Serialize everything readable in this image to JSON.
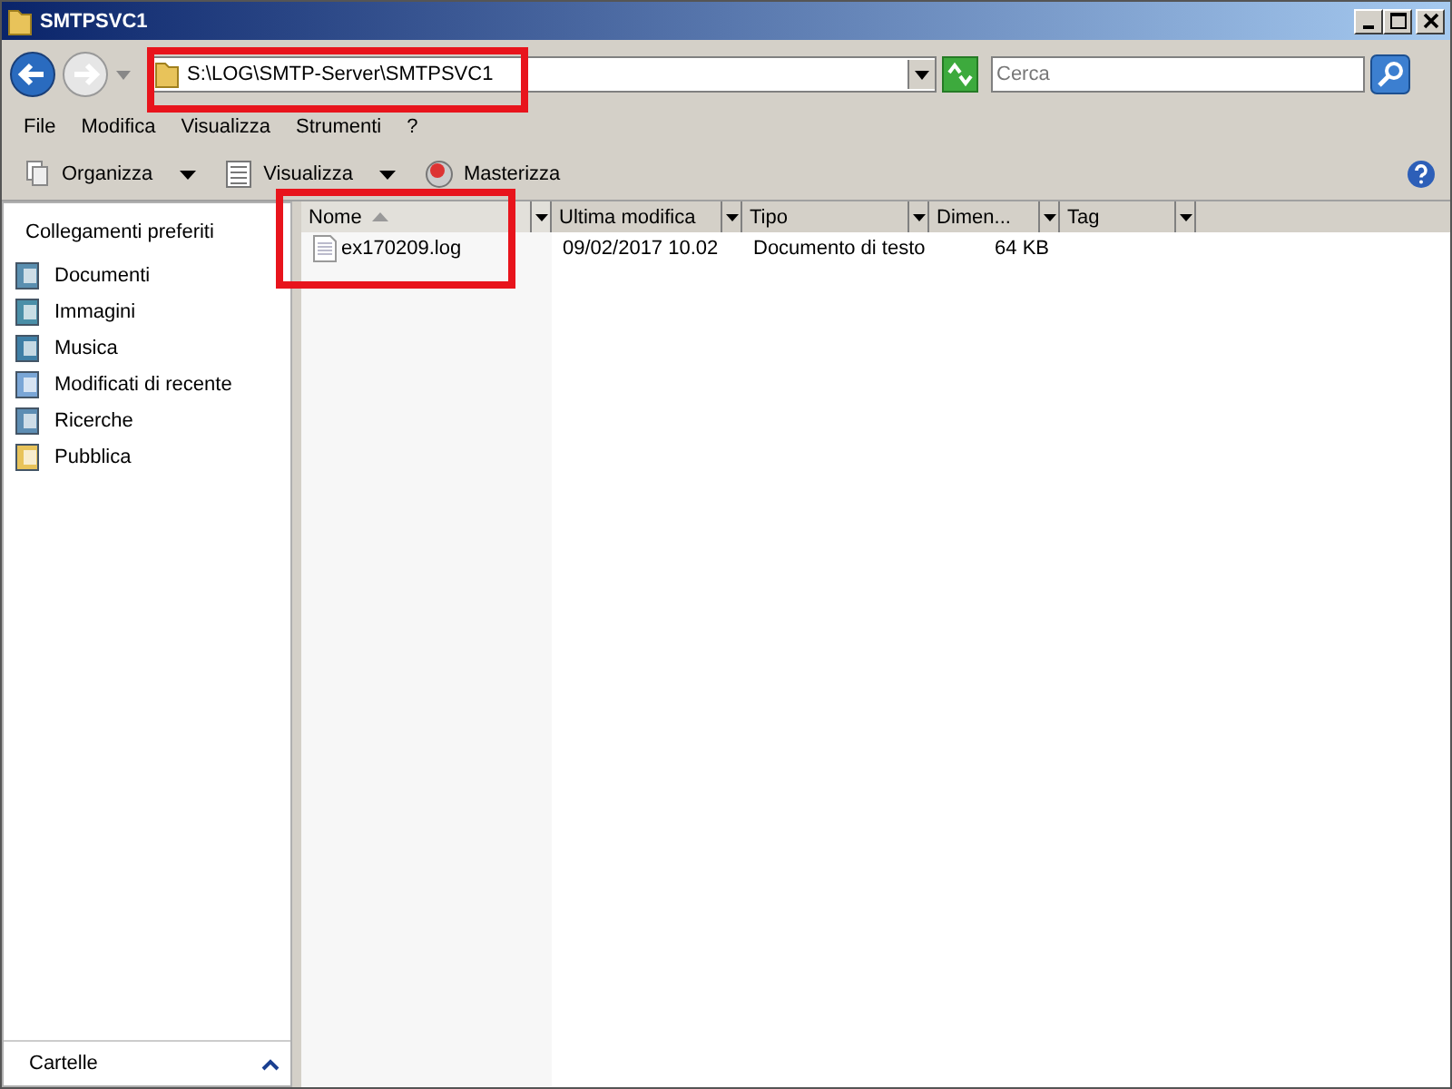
{
  "window": {
    "title": "SMTPSVC1"
  },
  "address": {
    "value": "S:\\LOG\\SMTP-Server\\SMTPSVC1"
  },
  "search": {
    "placeholder": "Cerca"
  },
  "menu": [
    "File",
    "Modifica",
    "Visualizza",
    "Strumenti",
    "?"
  ],
  "toolbar": [
    {
      "label": "Organizza",
      "kind": "organize"
    },
    {
      "label": "Visualizza",
      "kind": "views"
    },
    {
      "label": "Masterizza",
      "kind": "burn"
    }
  ],
  "sidebar": {
    "title": "Collegamenti preferiti",
    "items": [
      {
        "label": "Documenti",
        "kind": "documents"
      },
      {
        "label": "Immagini",
        "kind": "pictures"
      },
      {
        "label": "Musica",
        "kind": "music"
      },
      {
        "label": "Modificati di recente",
        "kind": "recent"
      },
      {
        "label": "Ricerche",
        "kind": "searches"
      },
      {
        "label": "Pubblica",
        "kind": "public"
      }
    ],
    "footer": "Cartelle"
  },
  "table": {
    "columns": [
      {
        "label": "Nome",
        "sorted": true
      },
      {
        "label": "Ultima modifica",
        "sorted": false
      },
      {
        "label": "Tipo",
        "sorted": false
      },
      {
        "label": "Dimen...",
        "sorted": false
      },
      {
        "label": "Tag",
        "sorted": false
      }
    ],
    "rows": [
      [
        "ex170209.log",
        "09/02/2017 10.02",
        "Documento di testo",
        "64 KB"
      ]
    ]
  }
}
